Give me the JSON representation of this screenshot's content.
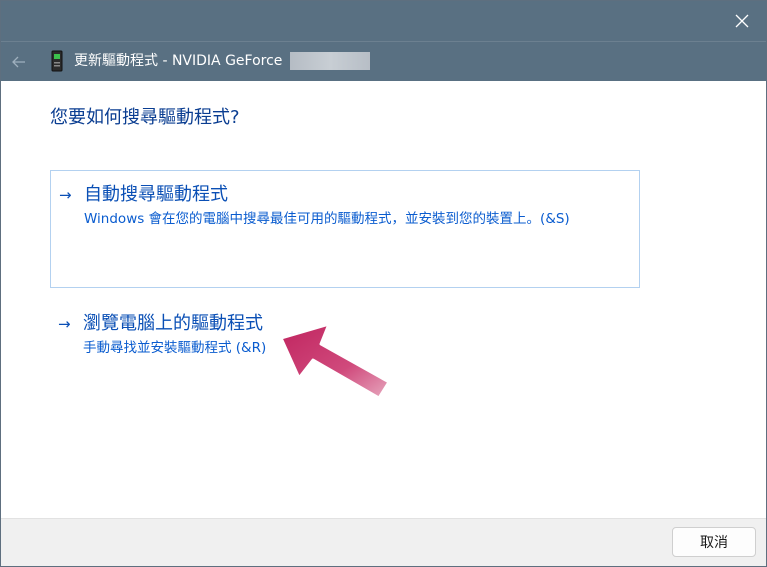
{
  "window": {
    "title": "更新驅動程式 - NVIDIA GeForce",
    "back_icon": "back-arrow-icon",
    "close_icon": "close-icon",
    "device_icon": "graphics-card-icon"
  },
  "main": {
    "heading": "您要如何搜尋驅動程式?",
    "options": [
      {
        "arrow": "→",
        "title": "自動搜尋驅動程式",
        "description": "Windows 會在您的電腦中搜尋最佳可用的驅動程式，並安裝到您的裝置上。(&S)"
      },
      {
        "arrow": "→",
        "title": "瀏覽電腦上的驅動程式",
        "description": "手動尋找並安裝驅動程式 (&R)"
      }
    ]
  },
  "annotation": {
    "icon": "pointer-arrow-annotation",
    "color": "#c8336e"
  },
  "footer": {
    "cancel_label": "取消"
  },
  "colors": {
    "titlebar": "#597082",
    "link": "#0a4fb5",
    "heading": "#0a3d91",
    "selection_border": "#b3d1f0"
  }
}
